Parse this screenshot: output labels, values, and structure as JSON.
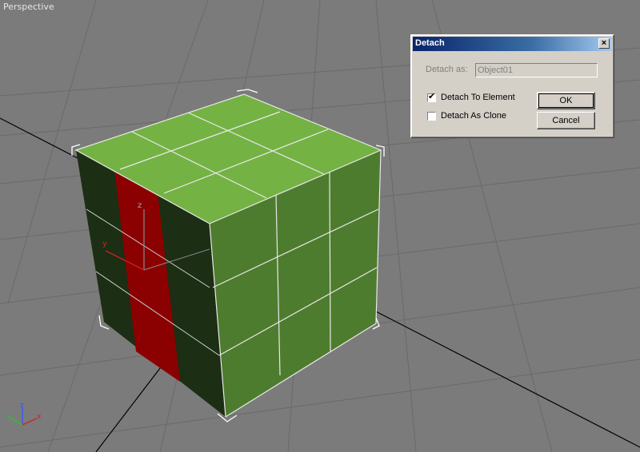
{
  "viewport": {
    "label": "Perspective",
    "axis": {
      "x": "x",
      "y": "y",
      "z": "z"
    },
    "colors": {
      "background": "#7b7b7b",
      "top_face": "#74b244",
      "right_face": "#4e7c2e",
      "left_face": "#1c2e14",
      "selected_polys": "#8b0000"
    }
  },
  "dialog": {
    "title": "Detach",
    "close_label": "×",
    "detach_as_label": "Detach as:",
    "detach_as_value": "Object01",
    "detach_to_element": {
      "label": "Detach To Element",
      "checked": true
    },
    "detach_as_clone": {
      "label": "Detach As Clone",
      "checked": false
    },
    "ok_label": "OK",
    "cancel_label": "Cancel"
  }
}
